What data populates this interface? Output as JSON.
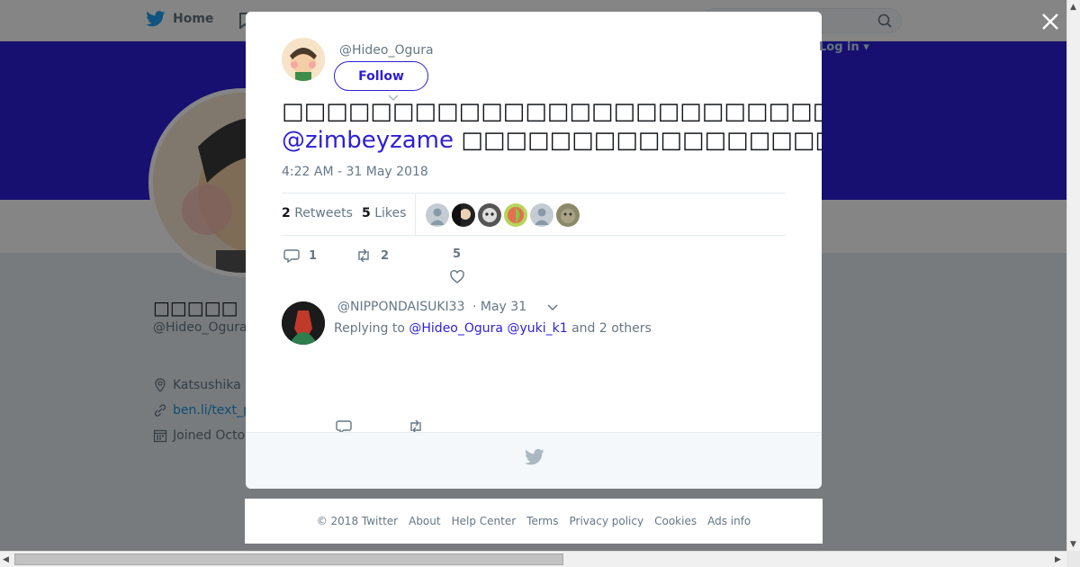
{
  "nav": {
    "home_label": "Home",
    "login_label": "Log in"
  },
  "profile": {
    "name": "□□□□□",
    "handle": "@Hideo_Ogura",
    "location": "Katsushika",
    "website": "ben.li/text_p",
    "joined": "Joined Octo"
  },
  "tweet": {
    "handle": "@Hideo_Ogura",
    "follow_label": "Follow",
    "text_line1": "□□□□□□□□□□□□□□□□□□□□□□□□□□□□□□□□□□□□□□□□□□□□□□□□□□",
    "mention": "@zimbeyzame",
    "text_line2_rest": "□□□□□□□□□□□□□□□□□□□",
    "timestamp": "4:22 AM - 31 May 2018",
    "retweet_count": "2",
    "retweet_label": "Retweets",
    "like_count": "5",
    "like_label": "Likes",
    "reply_action_count": "1",
    "retweet_action_count": "2",
    "like_action_count": "5"
  },
  "reply": {
    "handle": "@NIPPONDAISUKI33",
    "date": "· May 31",
    "replying_prefix": "Replying to",
    "mention1": "@Hideo_Ogura",
    "mention2": "@yuki_k1",
    "suffix": "and 2 others"
  },
  "footer": {
    "links": [
      "© 2018 Twitter",
      "About",
      "Help Center",
      "Terms",
      "Privacy policy",
      "Cookies",
      "Ads info"
    ]
  },
  "colors": {
    "accent": "#2d1fd6",
    "twitter_blue": "#1da1f2",
    "muted": "#657786"
  }
}
